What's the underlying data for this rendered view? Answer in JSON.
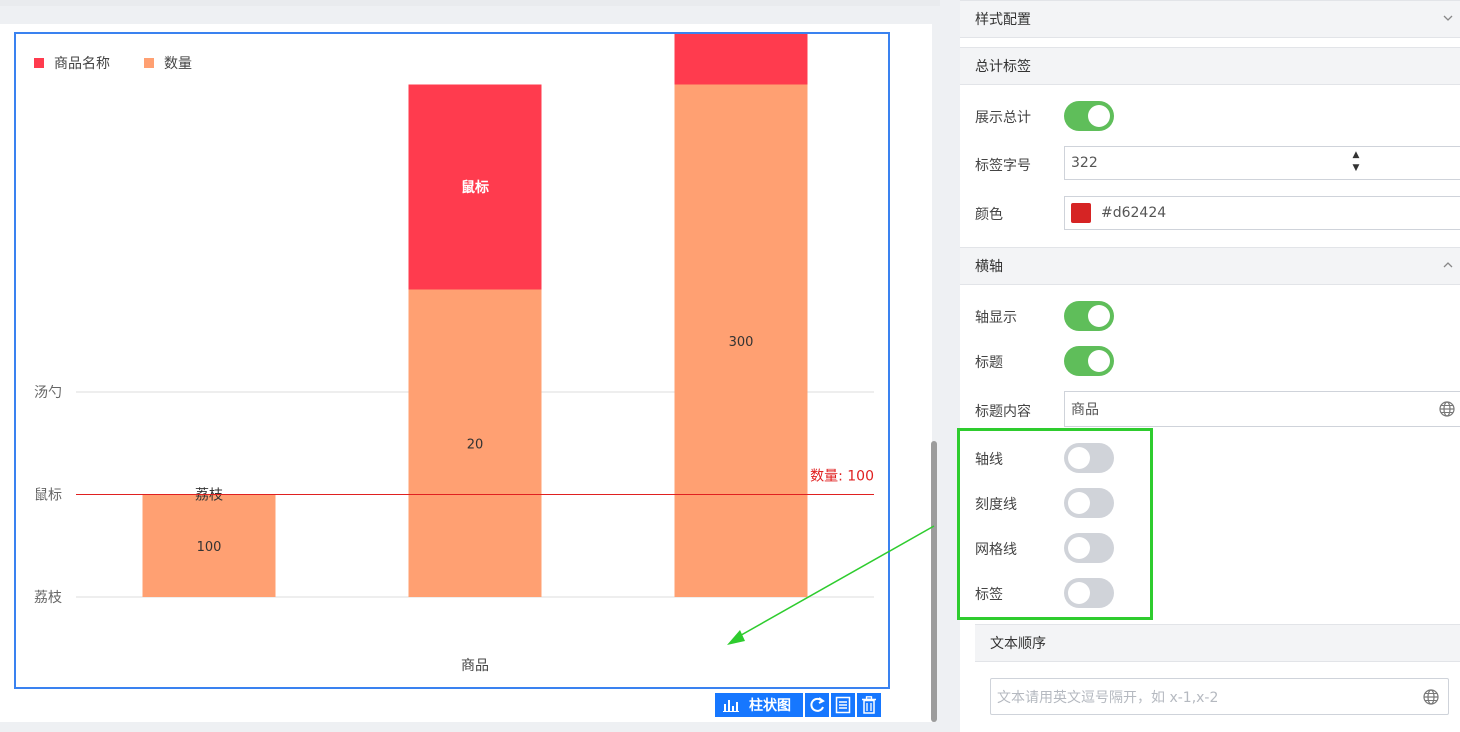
{
  "chart_data": {
    "type": "bar",
    "stacked": true,
    "legend": [
      "商品名称",
      "数量"
    ],
    "colors": {
      "商品名称": "#ff3b4e",
      "数量": "#ffa072"
    },
    "y_category_labels": [
      "荔枝",
      "鼠标",
      "汤勺"
    ],
    "y_category_values": [
      0,
      100,
      200
    ],
    "categories": [
      "荔枝",
      "鼠标",
      "汤勺"
    ],
    "series": [
      {
        "name": "数量",
        "values": [
          100,
          300,
          500
        ],
        "labels": [
          "100",
          "20",
          "300"
        ]
      },
      {
        "name": "商品名称",
        "values": [
          0,
          200,
          400
        ],
        "labels": [
          "荔枝",
          "鼠标",
          "汤勺"
        ]
      }
    ],
    "markline": {
      "value": 100,
      "label": "数量: 100",
      "color": "#e02020"
    },
    "xlabel": "商品",
    "ylim": [
      0,
      900
    ]
  },
  "toolbar": {
    "chart_type_label": "柱状图"
  },
  "panel": {
    "style_config": "样式配置",
    "total_label_section": "总计标签",
    "show_total": "展示总计",
    "label_font_size": "标签字号",
    "label_font_size_value": "322",
    "color_label": "颜色",
    "color_value": "#d62424",
    "x_axis_section": "横轴",
    "axis_show": "轴显示",
    "title": "标题",
    "title_content": "标题内容",
    "title_content_value": "商品",
    "axis_line": "轴线",
    "tick_line": "刻度线",
    "grid_line": "网格线",
    "label": "标签",
    "text_order": "文本顺序",
    "text_order_placeholder": "文本请用英文逗号隔开，如 x-1,x-2"
  },
  "toggles": {
    "show_total": true,
    "axis_show": true,
    "title": true,
    "axis_line": false,
    "tick_line": false,
    "grid_line": false,
    "label": false
  }
}
